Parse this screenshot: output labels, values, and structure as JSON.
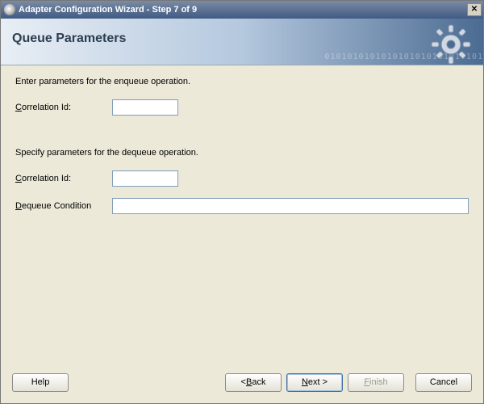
{
  "window": {
    "title": "Adapter Configuration Wizard - Step 7 of 9"
  },
  "header": {
    "step_title": "Queue Parameters",
    "binary": "0101010101010101010101010101"
  },
  "form": {
    "enqueue_instr": "Enter parameters for the enqueue operation.",
    "enqueue_corr_label_pre": "C",
    "enqueue_corr_label_post": "orrelation Id:",
    "enqueue_corr_value": "",
    "dequeue_instr": "Specify parameters for the dequeue operation.",
    "dequeue_corr_label_pre": "C",
    "dequeue_corr_label_post": "orrelation Id:",
    "dequeue_corr_value": "",
    "dequeue_cond_label_pre": "D",
    "dequeue_cond_label_post": "equeue Condition",
    "dequeue_cond_value": ""
  },
  "buttons": {
    "help": "Help",
    "back_pre": "< ",
    "back_mn": "B",
    "back_post": "ack",
    "next_pre": "",
    "next_mn": "N",
    "next_post": "ext >",
    "finish_pre": "",
    "finish_mn": "F",
    "finish_post": "inish",
    "cancel": "Cancel"
  }
}
